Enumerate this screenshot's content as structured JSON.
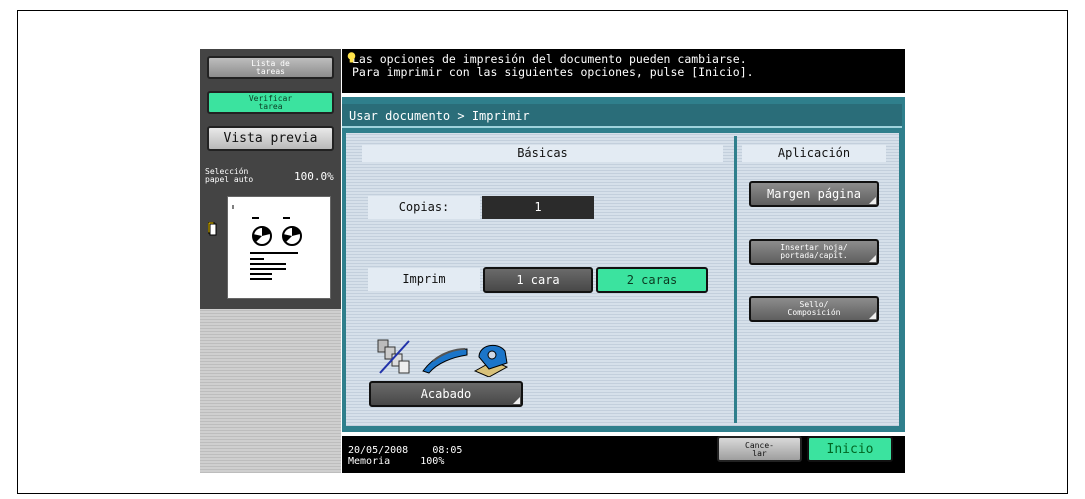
{
  "sidebar": {
    "job_list_label": "Lista de\ntareas",
    "check_job_label": "Verificar\ntarea",
    "preview_label": "Vista previa",
    "paper_label": "Selección\npapel auto",
    "zoom_value": "100.0%"
  },
  "header": {
    "message": "Las opciones de impresión del documento pueden cambiarse.\nPara imprimir con las siguientes opciones, pulse [Inicio]."
  },
  "main": {
    "breadcrumb": "Usar documento > Imprimir",
    "basic_tab": "Básicas",
    "application_tab": "Aplicación",
    "copies_label": "Copias:",
    "copies_value": "1",
    "print_label": "Imprim",
    "print_options": [
      "1 cara",
      "2 caras"
    ],
    "print_selected": "2 caras",
    "finishing_label": "Acabado",
    "app_buttons": [
      "Margen página",
      "Insertar hoja/\nportada/capít.",
      "Sello/\nComposición"
    ]
  },
  "footer": {
    "date": "20/05/2008",
    "time": "08:05",
    "memory_label": "Memoria",
    "memory_value": "100%",
    "cancel_label": "Cance-\nlar",
    "start_label": "Inicio"
  },
  "colors": {
    "teal": "#2f7f8c",
    "green_selected": "#3be39f",
    "dark_button": "#484848"
  }
}
